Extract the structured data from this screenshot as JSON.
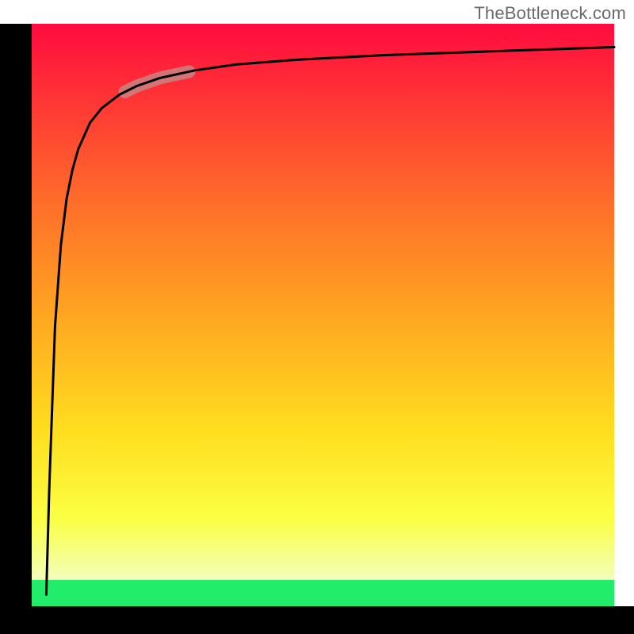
{
  "watermark": "TheBottleneck.com",
  "gradient": {
    "stops": [
      "#ff0b3e",
      "#ff6b2a",
      "#ffa621",
      "#ffde1f",
      "#fbff43",
      "#f2ffbc"
    ],
    "green": "#21ed6a"
  },
  "highlight": {
    "color": "#c58b86",
    "opacity": 0.78,
    "stroke_width": 16
  },
  "curve": {
    "color": "#000000",
    "stroke_width": 3
  },
  "chart_data": {
    "type": "line",
    "title": "",
    "xlabel": "",
    "ylabel": "",
    "xlim": [
      0,
      100
    ],
    "ylim": [
      0,
      100
    ],
    "series": [
      {
        "name": "bottleneck-curve",
        "x": [
          2.5,
          3.0,
          4.0,
          5.0,
          6.0,
          7.0,
          8.0,
          10.0,
          12.0,
          15.0,
          18.0,
          22.0,
          28.0,
          35.0,
          45.0,
          60.0,
          80.0,
          100.0
        ],
        "y": [
          2.0,
          20.0,
          48.0,
          62.0,
          70.0,
          75.0,
          78.5,
          83.0,
          85.5,
          87.8,
          89.3,
          90.7,
          92.0,
          93.0,
          93.8,
          94.6,
          95.3,
          96.0
        ]
      }
    ],
    "annotations": [
      {
        "type": "highlight-segment",
        "x_range": [
          16,
          27
        ],
        "note": "thick pale stroke over the curve"
      }
    ]
  }
}
